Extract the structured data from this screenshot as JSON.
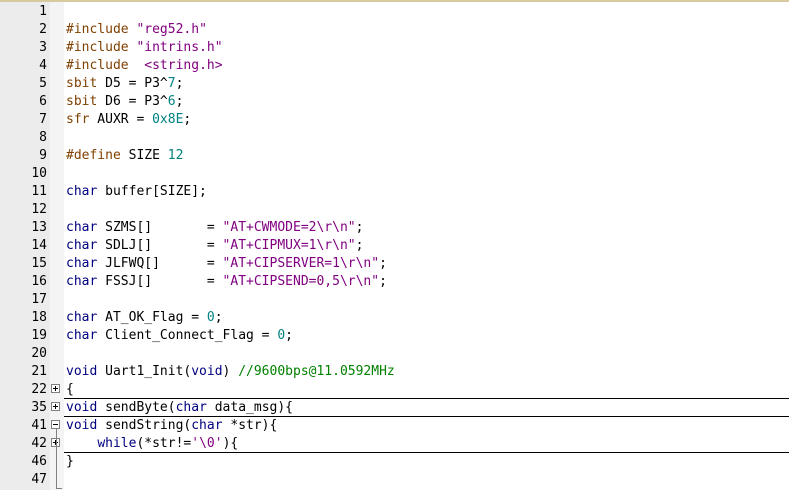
{
  "editor": {
    "lines": [
      {
        "n": "1",
        "tokens": []
      },
      {
        "n": "2",
        "tokens": [
          {
            "t": "#include ",
            "c": "pp"
          },
          {
            "t": "\"reg52.h\"",
            "c": "str"
          }
        ]
      },
      {
        "n": "3",
        "tokens": [
          {
            "t": "#include ",
            "c": "pp"
          },
          {
            "t": "\"intrins.h\"",
            "c": "str"
          }
        ]
      },
      {
        "n": "4",
        "tokens": [
          {
            "t": "#include  ",
            "c": "pp"
          },
          {
            "t": "<string.h>",
            "c": "str"
          }
        ]
      },
      {
        "n": "5",
        "tokens": [
          {
            "t": "sbit",
            "c": "pp"
          },
          {
            "t": " D5 = P3^",
            "c": ""
          },
          {
            "t": "7",
            "c": "num"
          },
          {
            "t": ";",
            "c": ""
          }
        ]
      },
      {
        "n": "6",
        "tokens": [
          {
            "t": "sbit",
            "c": "pp"
          },
          {
            "t": " D6 = P3^",
            "c": ""
          },
          {
            "t": "6",
            "c": "num"
          },
          {
            "t": ";",
            "c": ""
          }
        ]
      },
      {
        "n": "7",
        "tokens": [
          {
            "t": "sfr",
            "c": "pp"
          },
          {
            "t": " AUXR = ",
            "c": ""
          },
          {
            "t": "0x8E",
            "c": "num"
          },
          {
            "t": ";",
            "c": ""
          }
        ]
      },
      {
        "n": "8",
        "tokens": []
      },
      {
        "n": "9",
        "tokens": [
          {
            "t": "#define ",
            "c": "pp"
          },
          {
            "t": "SIZE ",
            "c": ""
          },
          {
            "t": "12",
            "c": "num"
          }
        ]
      },
      {
        "n": "10",
        "tokens": []
      },
      {
        "n": "11",
        "tokens": [
          {
            "t": "char",
            "c": "kw"
          },
          {
            "t": " buffer[SIZE];",
            "c": ""
          }
        ]
      },
      {
        "n": "12",
        "tokens": []
      },
      {
        "n": "13",
        "tokens": [
          {
            "t": "char",
            "c": "kw"
          },
          {
            "t": " SZMS[]       = ",
            "c": ""
          },
          {
            "t": "\"AT+CWMODE=2\\r\\n\"",
            "c": "str"
          },
          {
            "t": ";",
            "c": ""
          }
        ]
      },
      {
        "n": "14",
        "tokens": [
          {
            "t": "char",
            "c": "kw"
          },
          {
            "t": " SDLJ[]       = ",
            "c": ""
          },
          {
            "t": "\"AT+CIPMUX=1\\r\\n\"",
            "c": "str"
          },
          {
            "t": ";",
            "c": ""
          }
        ]
      },
      {
        "n": "15",
        "tokens": [
          {
            "t": "char",
            "c": "kw"
          },
          {
            "t": " JLFWQ[]      = ",
            "c": ""
          },
          {
            "t": "\"AT+CIPSERVER=1\\r\\n\"",
            "c": "str"
          },
          {
            "t": ";",
            "c": ""
          }
        ]
      },
      {
        "n": "16",
        "tokens": [
          {
            "t": "char",
            "c": "kw"
          },
          {
            "t": " FSSJ[]       = ",
            "c": ""
          },
          {
            "t": "\"AT+CIPSEND=0,5\\r\\n\"",
            "c": "str"
          },
          {
            "t": ";",
            "c": ""
          }
        ]
      },
      {
        "n": "17",
        "tokens": []
      },
      {
        "n": "18",
        "tokens": [
          {
            "t": "char",
            "c": "kw"
          },
          {
            "t": " AT_OK_Flag = ",
            "c": ""
          },
          {
            "t": "0",
            "c": "num"
          },
          {
            "t": ";",
            "c": ""
          }
        ]
      },
      {
        "n": "19",
        "tokens": [
          {
            "t": "char",
            "c": "kw"
          },
          {
            "t": " Client_Connect_Flag = ",
            "c": ""
          },
          {
            "t": "0",
            "c": "num"
          },
          {
            "t": ";",
            "c": ""
          }
        ]
      },
      {
        "n": "20",
        "tokens": []
      },
      {
        "n": "21",
        "tokens": [
          {
            "t": "void",
            "c": "kw"
          },
          {
            "t": " Uart1_Init(",
            "c": ""
          },
          {
            "t": "void",
            "c": "kw"
          },
          {
            "t": ") ",
            "c": ""
          },
          {
            "t": "//9600bps@11.0592MHz",
            "c": "cm"
          }
        ]
      },
      {
        "n": "22",
        "fold": "plus",
        "tokens": [
          {
            "t": "{",
            "c": ""
          }
        ]
      },
      {
        "n": "35",
        "fold": "plus",
        "tokens": [
          {
            "t": "void",
            "c": "kw"
          },
          {
            "t": " sendByte(",
            "c": ""
          },
          {
            "t": "char",
            "c": "kw"
          },
          {
            "t": " data_msg){",
            "c": ""
          }
        ]
      },
      {
        "n": "41",
        "fold": "minus",
        "tokens": [
          {
            "t": "void",
            "c": "kw"
          },
          {
            "t": " sendString(",
            "c": ""
          },
          {
            "t": "char",
            "c": "kw"
          },
          {
            "t": " *str){",
            "c": ""
          }
        ]
      },
      {
        "n": "42",
        "fold": "plus",
        "tokens": [
          {
            "t": "    ",
            "c": ""
          },
          {
            "t": "while",
            "c": "kw"
          },
          {
            "t": "(*str!=",
            "c": ""
          },
          {
            "t": "'\\0'",
            "c": "str"
          },
          {
            "t": "){",
            "c": ""
          }
        ]
      },
      {
        "n": "46",
        "tokens": [
          {
            "t": "}",
            "c": ""
          }
        ]
      },
      {
        "n": "47",
        "tokens": []
      }
    ]
  }
}
